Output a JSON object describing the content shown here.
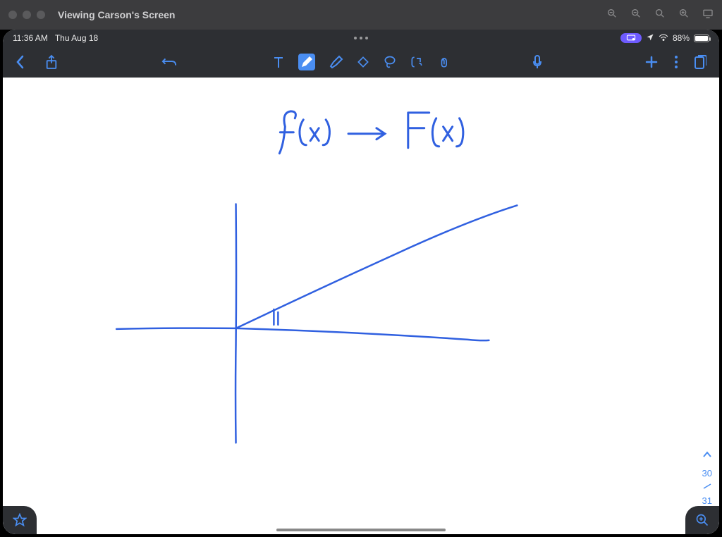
{
  "window": {
    "title": "Viewing Carson's Screen"
  },
  "statusbar": {
    "time": "11:36 AM",
    "date": "Thu Aug 18",
    "battery_pct": "88%"
  },
  "handwriting": {
    "formula_left": "f(x)",
    "formula_right": "F(x)"
  },
  "page_indicator": {
    "current": "30",
    "next": "31"
  },
  "colors": {
    "accent": "#4a8ef2",
    "ink": "#3060e0",
    "titlebar": "#3c3c3e",
    "toolbar": "#2d2f33"
  }
}
